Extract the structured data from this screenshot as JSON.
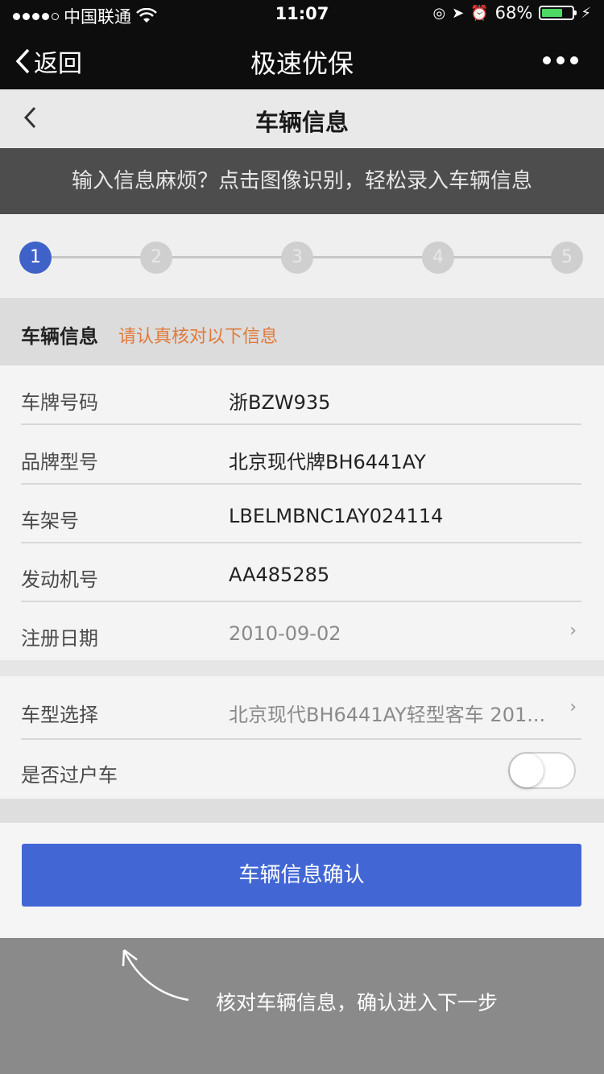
{
  "status_bar": {
    "carrier": "中国联通",
    "time": "11:07",
    "battery": "68%",
    "battery_level": 0.68
  },
  "wechat_bar": {
    "back_label": "返回",
    "title": "极速优保",
    "more_icon": "more-dots-icon"
  },
  "nav": {
    "title": "车辆信息",
    "back_icon": "chevron-left-icon"
  },
  "banner": {
    "text": "输入信息麻烦？点击图像识别，轻松录入车辆信息"
  },
  "steps": {
    "items": [
      "1",
      "2",
      "3",
      "4",
      "5"
    ],
    "active": "1"
  },
  "section": {
    "title": "车辆信息",
    "hint": "请认真核对以下信息"
  },
  "vehicle_fields": [
    {
      "label": "车牌号码",
      "value": "浙BZW935"
    },
    {
      "label": "品牌型号",
      "value": "北京现代牌BH6441AY"
    },
    {
      "label": "车架号",
      "value": "LBELMBNC1AY024114"
    },
    {
      "label": "发动机号",
      "value": "AA485285"
    },
    {
      "label": "注册日期",
      "value": "2010-09-02"
    }
  ],
  "model_select": {
    "label": "车型选择",
    "value": "北京现代BH6441AY轻型客车 201..."
  },
  "transfer": {
    "label": "是否过户车",
    "on": false
  },
  "confirm_button": {
    "label": "车辆信息确认"
  },
  "tip": {
    "text": "核对车辆信息，确认进入下一步"
  },
  "colors": {
    "accent": "#4267d5",
    "hint": "#e07a3a",
    "active_step": "#3f62c8"
  }
}
